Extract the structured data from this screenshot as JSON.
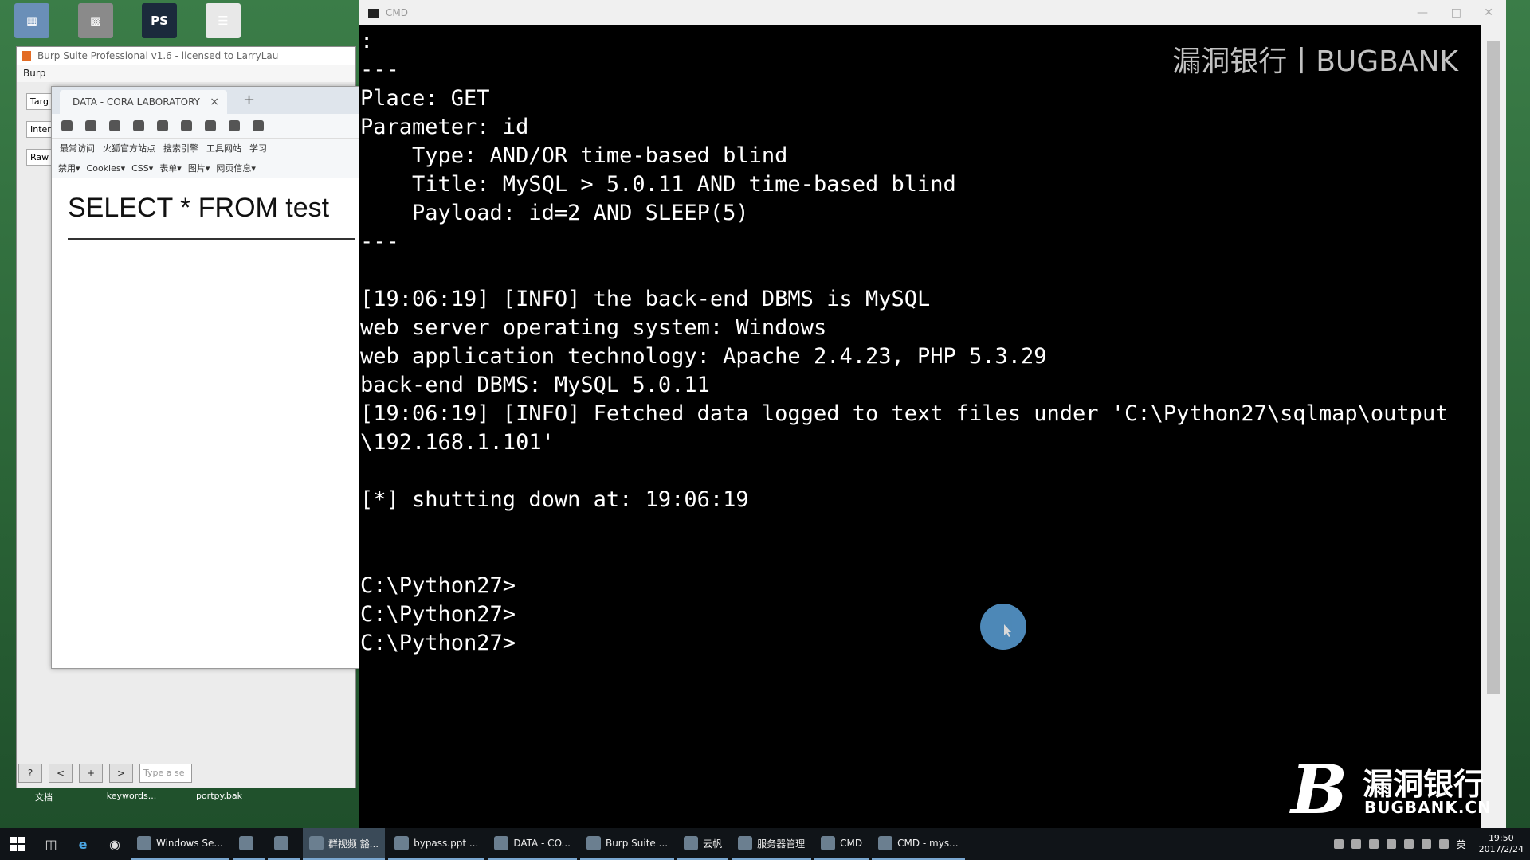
{
  "desktop": {
    "top_icons": [
      {
        "name": "computer-icon",
        "glyph": "▦",
        "color": "#6a8fb8"
      },
      {
        "name": "recycle-icon",
        "glyph": "▩",
        "color": "#8a8a8a"
      },
      {
        "name": "photoshop-icon",
        "glyph": "PS",
        "color": "#1b2a3c"
      },
      {
        "name": "document-icon",
        "glyph": "☰",
        "color": "#e8e8e8"
      }
    ],
    "bottom_icons": [
      {
        "label": "文档"
      },
      {
        "label": "keywords..."
      },
      {
        "label": "portpy.bak"
      }
    ]
  },
  "burp": {
    "title": "Burp Suite Professional v1.6 - licensed to LarryLau",
    "menu": "Burp",
    "tabs": [
      "Targ",
      "Inter",
      "Raw"
    ],
    "bottom_buttons": [
      "?",
      "<",
      "+",
      ">"
    ],
    "search_placeholder": "Type a se"
  },
  "firefox": {
    "tab_title": "DATA - CORA LABORATORY",
    "tab_close": "×",
    "new_tab": "+",
    "bookmarks": [
      "最常访问",
      "火狐官方站点",
      "搜索引擎",
      "工具网站",
      "学习"
    ],
    "hackbar": [
      "禁用▾",
      "Cookies▾",
      "CSS▾",
      "表单▾",
      "图片▾",
      "网页信息▾"
    ],
    "content_text": "SELECT * FROM test"
  },
  "cmd": {
    "title": "CMD",
    "lines": [
      ":",
      "---",
      "Place: GET",
      "Parameter: id",
      "    Type: AND/OR time-based blind",
      "    Title: MySQL > 5.0.11 AND time-based blind",
      "    Payload: id=2 AND SLEEP(5)",
      "---",
      "",
      "[19:06:19] [INFO] the back-end DBMS is MySQL",
      "web server operating system: Windows",
      "web application technology: Apache 2.4.23, PHP 5.3.29",
      "back-end DBMS: MySQL 5.0.11",
      "[19:06:19] [INFO] Fetched data logged to text files under 'C:\\Python27\\sqlmap\\output",
      "\\192.168.1.101'",
      "",
      "[*] shutting down at: 19:06:19",
      "",
      "",
      "C:\\Python27>",
      "C:\\Python27>",
      "C:\\Python27>"
    ]
  },
  "watermark": {
    "top_text": "漏洞银行丨BUGBANK",
    "bottom_cn": "漏洞银行",
    "bottom_en": "BUGBANK.CN"
  },
  "taskbar": {
    "items": [
      {
        "label": "Windows Se...",
        "active": false
      },
      {
        "label": "",
        "active": false
      },
      {
        "label": "",
        "active": false
      },
      {
        "label": "群视频 豁...",
        "active": true
      },
      {
        "label": "bypass.ppt ...",
        "active": false
      },
      {
        "label": "DATA - CO...",
        "active": false
      },
      {
        "label": "Burp Suite ...",
        "active": false
      },
      {
        "label": "云帆",
        "active": false
      },
      {
        "label": "服务器管理",
        "active": false
      },
      {
        "label": "CMD",
        "active": false
      },
      {
        "label": "CMD - mys...",
        "active": false
      }
    ],
    "clock_time": "19:50",
    "clock_date": "2017/2/24",
    "ime": "英"
  }
}
